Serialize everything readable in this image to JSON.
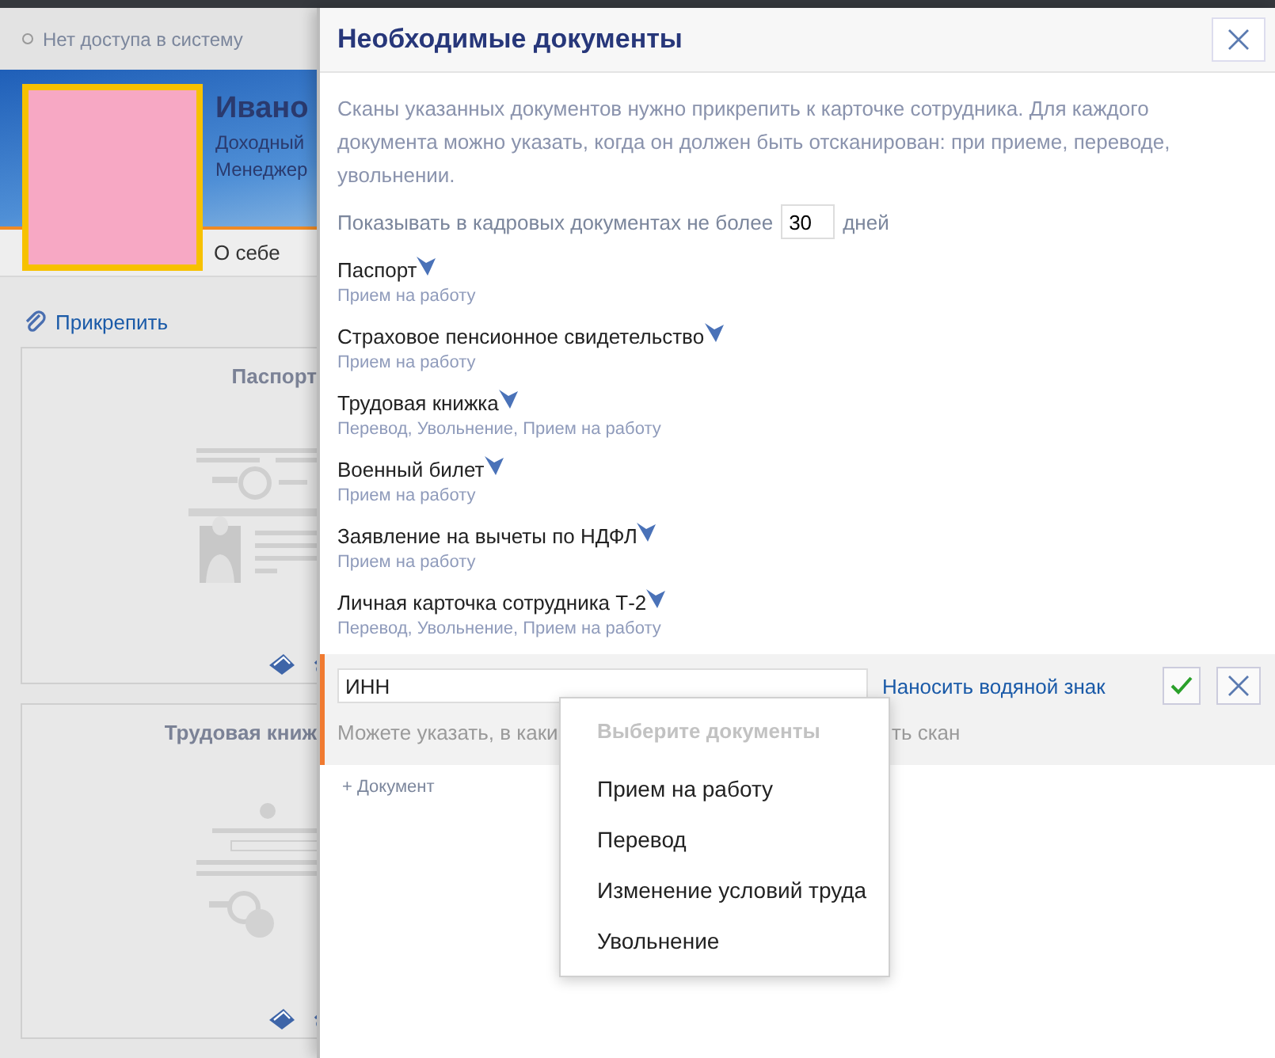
{
  "status": {
    "text": "Нет доступа в систему"
  },
  "profile": {
    "name": "Ивано",
    "line_1": "Доходный",
    "line_2": "Менеджер",
    "tab": "О себе"
  },
  "attach_link": "Прикрепить",
  "cards": [
    {
      "title": "Паспорт",
      "kind": "passport"
    },
    {
      "title": "Трудовая книж",
      "kind": "workbook"
    }
  ],
  "dialog": {
    "title": "Необходимые документы",
    "description": "Сканы указанных документов нужно прикрепить к карточке сотрудника. Для каждого документа можно указать, когда он должен быть отсканирован: при приеме, переводе, увольнении.",
    "days_prefix": "Показывать в кадровых документах не более",
    "days_value": "30",
    "days_suffix": "дней",
    "documents": [
      {
        "name": "Паспорт",
        "events": "Прием на работу"
      },
      {
        "name": "Страховое пенсионное свидетельство",
        "events": "Прием на работу"
      },
      {
        "name": "Трудовая книжка",
        "events": "Перевод, Увольнение, Прием на работу"
      },
      {
        "name": "Военный билет",
        "events": "Прием на работу"
      },
      {
        "name": "Заявление на вычеты по НДФЛ",
        "events": "Прием на работу"
      },
      {
        "name": "Личная карточка сотрудника Т-2",
        "events": "Перевод, Увольнение, Прием на работу"
      }
    ],
    "editor": {
      "value": "ИНН",
      "watermark_link": "Наносить водяной знак",
      "hint_start": "Можете указать, в каки",
      "hint_end": "ть скан"
    },
    "add_link": "+ Документ"
  },
  "menu": {
    "header": "Выберите документы",
    "items": [
      "Прием на работу",
      "Перевод",
      "Изменение условий труда",
      "Увольнение"
    ]
  }
}
